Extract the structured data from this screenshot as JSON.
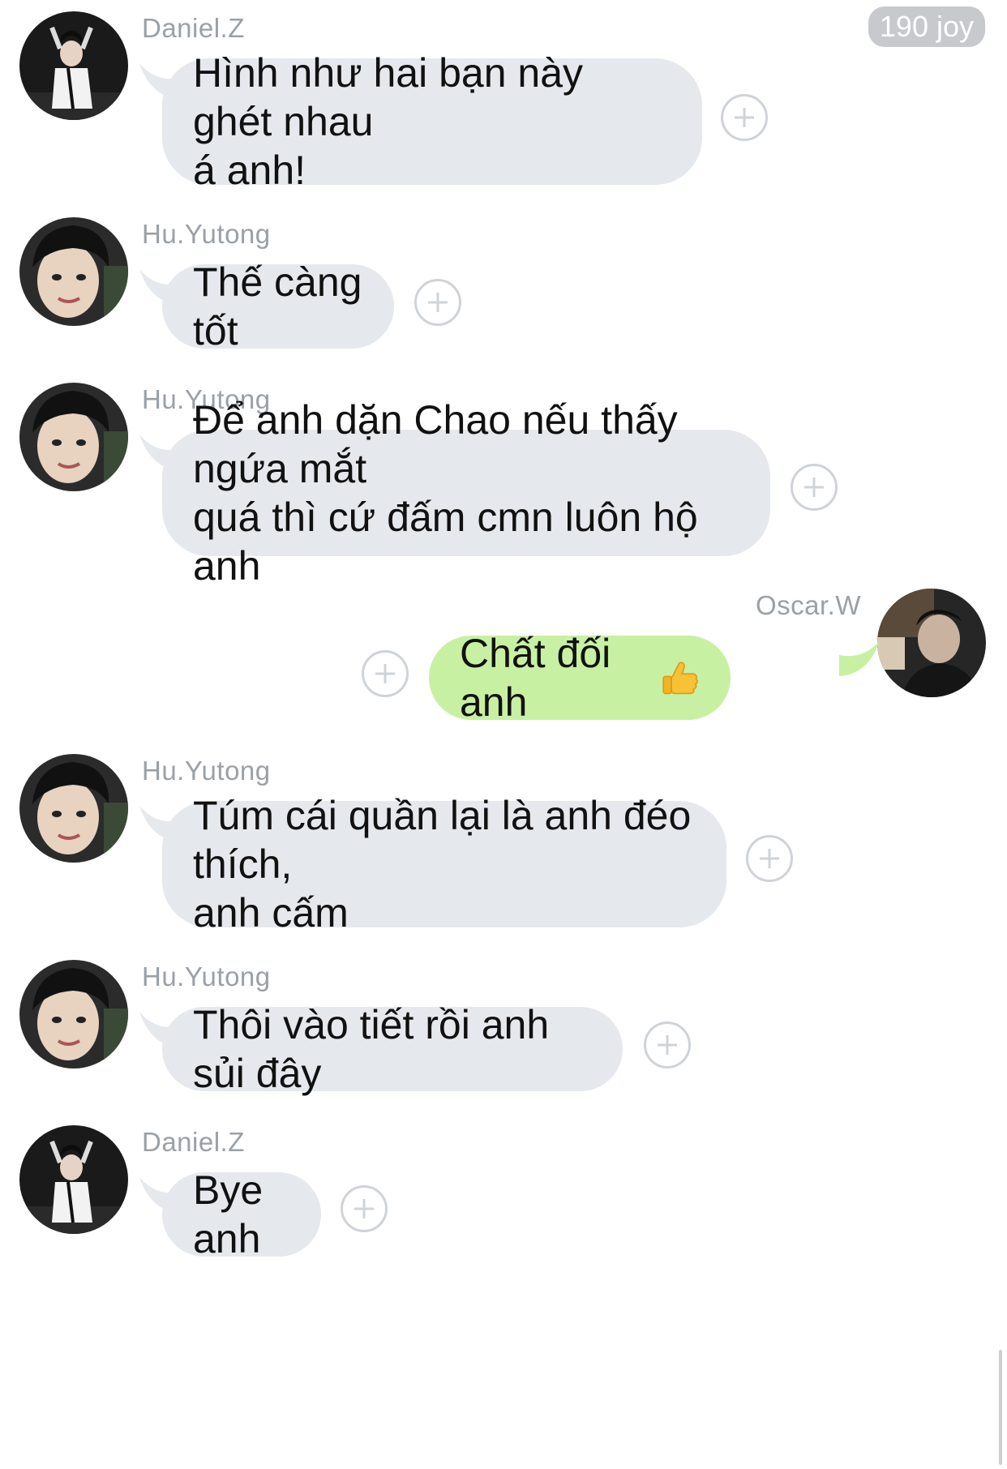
{
  "header": {
    "joy_badge": "190 joy"
  },
  "messages": [
    {
      "sender": "Daniel.Z",
      "lines": [
        "Hình như hai bạn này ghét nhau",
        "á anh!"
      ],
      "side": "left",
      "avatar": "daniel"
    },
    {
      "sender": "Hu.Yutong",
      "lines": [
        "Thế càng tốt"
      ],
      "side": "left",
      "avatar": "hu"
    },
    {
      "sender": "Hu.Yutong",
      "lines": [
        "Để anh dặn Chao nếu thấy ngứa mắt",
        "quá thì cứ đấm cmn luôn hộ anh"
      ],
      "side": "left",
      "avatar": "hu"
    },
    {
      "sender": "Oscar.W",
      "lines": [
        "Chất đối anh"
      ],
      "emoji": "thumbs-up",
      "side": "right",
      "avatar": "oscar"
    },
    {
      "sender": "Hu.Yutong",
      "lines": [
        "Túm cái quần lại là anh đéo thích,",
        "anh cấm"
      ],
      "side": "left",
      "avatar": "hu"
    },
    {
      "sender": "Hu.Yutong",
      "lines": [
        "Thôi vào tiết rồi anh sủi đây"
      ],
      "side": "left",
      "avatar": "hu"
    },
    {
      "sender": "Daniel.Z",
      "lines": [
        "Bye anh"
      ],
      "side": "left",
      "avatar": "daniel"
    }
  ],
  "icons": {
    "add_reaction": "plus-circle-icon",
    "emoji": "thumbs-up-icon"
  },
  "colors": {
    "received_bubble": "#e5e8ec",
    "sent_bubble": "#c8f0a2",
    "sender_name": "#9aa0a6"
  }
}
